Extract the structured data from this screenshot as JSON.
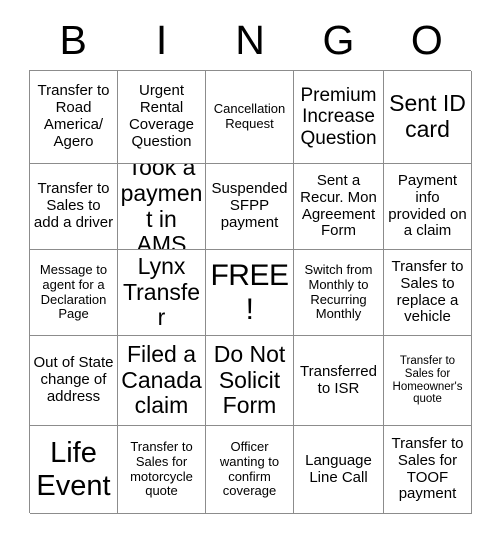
{
  "card": {
    "title": "BINGO",
    "header_letters": [
      "B",
      "I",
      "N",
      "G",
      "O"
    ],
    "grid_size": "5x5",
    "free_space": "FREE!",
    "cells": [
      {
        "text": "Transfer to Road America/ Agero",
        "size": "md"
      },
      {
        "text": "Urgent Rental Coverage Question",
        "size": "md"
      },
      {
        "text": "Cancellation Request",
        "size": "sm"
      },
      {
        "text": "Premium Increase Question",
        "size": "lg"
      },
      {
        "text": "Sent ID card",
        "size": "xl"
      },
      {
        "text": "Transfer to Sales to add a driver",
        "size": "md"
      },
      {
        "text": "Took a payment in AMS",
        "size": "xl"
      },
      {
        "text": "Suspended SFPP payment",
        "size": "md"
      },
      {
        "text": "Sent a Recur. Mon Agreement Form",
        "size": "md"
      },
      {
        "text": "Payment info provided on a claim",
        "size": "md"
      },
      {
        "text": "Message to agent for a Declaration Page",
        "size": "sm"
      },
      {
        "text": "Lynx Transfer",
        "size": "xl"
      },
      {
        "text": "FREE!",
        "size": "free"
      },
      {
        "text": "Switch from Monthly to Recurring Monthly",
        "size": "sm"
      },
      {
        "text": "Transfer to Sales to replace a vehicle",
        "size": "md"
      },
      {
        "text": "Out of State change of address",
        "size": "md"
      },
      {
        "text": "Filed a Canada claim",
        "size": "xl"
      },
      {
        "text": "Do Not Solicit Form",
        "size": "xl"
      },
      {
        "text": "Transferred to ISR",
        "size": "md"
      },
      {
        "text": "Transfer to Sales for Homeowner's quote",
        "size": "xs"
      },
      {
        "text": "Life Event",
        "size": "xxl"
      },
      {
        "text": "Transfer to Sales for motorcycle quote",
        "size": "sm"
      },
      {
        "text": "Officer wanting to confirm coverage",
        "size": "sm"
      },
      {
        "text": "Language Line Call",
        "size": "md"
      },
      {
        "text": "Transfer to Sales for TOOF payment",
        "size": "md"
      }
    ]
  }
}
